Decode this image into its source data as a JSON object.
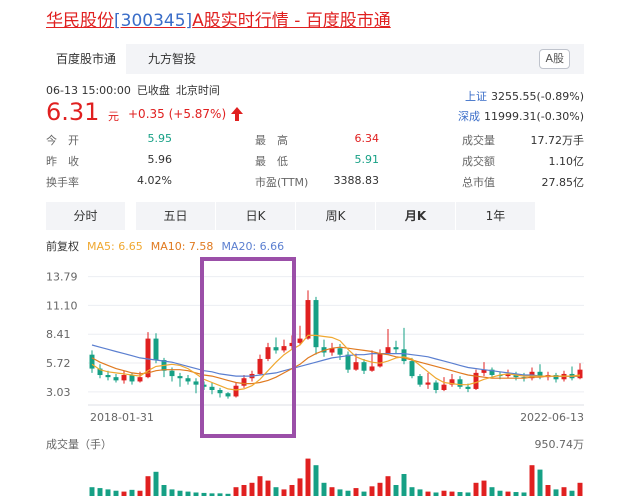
{
  "header": {
    "name": "华民股份",
    "code": "[300345]",
    "suffix": "A股实时行情 - 百度股市通"
  },
  "tabs": [
    {
      "label": "百度股市通",
      "active": true
    },
    {
      "label": "九方智投",
      "active": false
    }
  ],
  "market_badge": "A股",
  "status": {
    "datetime": "06-13 15:00:00",
    "state": "已收盘",
    "timezone": "北京时间"
  },
  "quote": {
    "price": "6.31",
    "unit": "元",
    "change": "+0.35 (+5.87%)"
  },
  "indices": [
    {
      "name": "上证",
      "value": "3255.55(-0.89%)"
    },
    {
      "name": "深成",
      "value": "11999.31(-0.30%)"
    }
  ],
  "stats": {
    "open": {
      "label": "今　开",
      "value": "5.95"
    },
    "prev": {
      "label": "昨　收",
      "value": "5.96"
    },
    "turnover": {
      "label": "换手率",
      "value": "4.02%"
    },
    "high": {
      "label": "最　高",
      "value": "6.34"
    },
    "low": {
      "label": "最　低",
      "value": "5.91"
    },
    "pe": {
      "label": "市盈(TTM)",
      "value": "3388.83"
    },
    "volume": {
      "label": "成交量",
      "value": "17.72万手"
    },
    "amount": {
      "label": "成交额",
      "value": "1.10亿"
    },
    "mktcap": {
      "label": "总市值",
      "value": "27.85亿"
    }
  },
  "periods": [
    {
      "label": "分时",
      "active": false
    },
    {
      "label": "五日",
      "active": false
    },
    {
      "label": "日K",
      "active": false
    },
    {
      "label": "周K",
      "active": false
    },
    {
      "label": "月K",
      "active": true
    },
    {
      "label": "1年",
      "active": false
    }
  ],
  "ma": {
    "label": "前复权",
    "ma5": "MA5: 6.65",
    "ma10": "MA10: 7.58",
    "ma20": "MA20: 6.66"
  },
  "colors": {
    "up": "#e02020",
    "down": "#16a085",
    "ma5": "#f0a830",
    "ma10": "#e07a20",
    "ma20": "#5b7fd0",
    "highlight": "#9b4fa8"
  },
  "volume_panel": {
    "title": "成交量（手）",
    "max_label": "950.74万"
  },
  "chart_data": {
    "type": "candlestick",
    "y_ticks": [
      "13.79",
      "11.10",
      "8.41",
      "5.72",
      "3.03"
    ],
    "ylim": [
      1.8,
      14.5
    ],
    "x_start": "2018-01-31",
    "x_end": "2022-06-13",
    "candles": [
      [
        6.5,
        5.2,
        6.9,
        4.8
      ],
      [
        5.2,
        4.6,
        5.6,
        4.3
      ],
      [
        4.6,
        4.4,
        5.0,
        4.1
      ],
      [
        4.4,
        4.1,
        4.7,
        3.9
      ],
      [
        4.1,
        4.6,
        5.0,
        3.8
      ],
      [
        4.6,
        4.0,
        4.8,
        3.7
      ],
      [
        4.0,
        4.4,
        4.9,
        3.9
      ],
      [
        4.4,
        8.0,
        8.6,
        4.3
      ],
      [
        8.0,
        6.0,
        8.5,
        5.7
      ],
      [
        6.0,
        5.0,
        6.2,
        4.4
      ],
      [
        5.0,
        4.5,
        5.3,
        4.0
      ],
      [
        4.5,
        4.3,
        4.8,
        3.5
      ],
      [
        4.3,
        4.0,
        4.6,
        3.7
      ],
      [
        4.0,
        3.7,
        4.3,
        2.9
      ],
      [
        3.7,
        3.5,
        4.0,
        3.2
      ],
      [
        3.5,
        3.2,
        3.9,
        2.8
      ],
      [
        3.2,
        2.9,
        3.4,
        2.5
      ],
      [
        2.9,
        2.6,
        3.0,
        2.4
      ],
      [
        2.6,
        3.6,
        3.9,
        2.5
      ],
      [
        3.6,
        4.3,
        4.6,
        3.4
      ],
      [
        4.3,
        4.7,
        5.0,
        4.0
      ],
      [
        4.7,
        6.1,
        6.5,
        4.6
      ],
      [
        6.1,
        7.2,
        7.6,
        5.9
      ],
      [
        7.2,
        6.9,
        8.1,
        6.6
      ],
      [
        6.9,
        7.3,
        7.9,
        6.7
      ],
      [
        7.3,
        7.6,
        8.3,
        7.0
      ],
      [
        7.6,
        8.0,
        9.2,
        7.4
      ],
      [
        8.0,
        11.6,
        12.5,
        7.9
      ],
      [
        11.6,
        7.2,
        11.9,
        6.5
      ],
      [
        7.2,
        6.7,
        7.9,
        6.3
      ],
      [
        6.7,
        7.1,
        7.6,
        6.4
      ],
      [
        7.1,
        6.5,
        7.5,
        6.0
      ],
      [
        6.5,
        5.1,
        6.8,
        4.8
      ],
      [
        5.1,
        5.8,
        6.6,
        5.0
      ],
      [
        5.8,
        5.0,
        6.1,
        4.7
      ],
      [
        5.0,
        5.4,
        6.9,
        4.9
      ],
      [
        5.4,
        6.6,
        7.0,
        5.3
      ],
      [
        6.6,
        7.2,
        8.9,
        6.5
      ],
      [
        7.2,
        7.0,
        7.8,
        6.6
      ],
      [
        7.0,
        5.9,
        9.0,
        5.6
      ],
      [
        5.9,
        4.5,
        6.2,
        4.3
      ],
      [
        4.5,
        3.7,
        4.7,
        3.5
      ],
      [
        3.7,
        3.9,
        4.8,
        3.3
      ],
      [
        3.9,
        3.2,
        4.1,
        2.9
      ],
      [
        3.2,
        3.7,
        4.4,
        3.1
      ],
      [
        3.7,
        4.2,
        4.7,
        3.5
      ],
      [
        4.2,
        3.5,
        4.5,
        3.3
      ],
      [
        3.5,
        3.3,
        3.8,
        3.0
      ],
      [
        3.3,
        4.8,
        5.1,
        3.2
      ],
      [
        4.8,
        5.1,
        5.8,
        4.5
      ],
      [
        5.1,
        4.6,
        5.3,
        4.3
      ],
      [
        4.6,
        4.5,
        4.9,
        4.2
      ],
      [
        4.5,
        4.7,
        5.1,
        4.3
      ],
      [
        4.7,
        4.4,
        4.9,
        4.1
      ],
      [
        4.4,
        4.3,
        4.8,
        4.0
      ],
      [
        4.3,
        4.9,
        5.3,
        4.1
      ],
      [
        4.9,
        4.4,
        5.6,
        4.2
      ],
      [
        4.4,
        4.6,
        4.9,
        4.1
      ],
      [
        4.6,
        4.2,
        4.8,
        3.9
      ],
      [
        4.2,
        4.7,
        5.0,
        4.0
      ],
      [
        4.7,
        4.3,
        5.4,
        4.1
      ],
      [
        4.3,
        5.1,
        5.7,
        4.2
      ]
    ],
    "ma5": [
      5.6,
      5.1,
      4.9,
      4.8,
      4.7,
      4.6,
      4.5,
      5.0,
      5.4,
      5.5,
      5.6,
      5.5,
      5.2,
      4.7,
      4.2,
      3.9,
      3.6,
      3.3,
      3.2,
      3.3,
      3.6,
      4.2,
      5.0,
      5.8,
      6.5,
      7.0,
      7.4,
      8.3,
      8.3,
      8.2,
      8.1,
      7.8,
      7.0,
      6.3,
      6.0,
      5.8,
      5.7,
      5.9,
      6.2,
      6.3,
      6.1,
      5.5,
      4.9,
      4.3,
      3.9,
      3.8,
      3.7,
      3.7,
      3.9,
      4.2,
      4.4,
      4.6,
      4.7,
      4.6,
      4.5,
      4.5,
      4.5,
      4.5,
      4.5,
      4.5,
      4.5,
      4.6
    ],
    "ma10": [
      6.2,
      5.8,
      5.5,
      5.2,
      5.0,
      4.8,
      4.7,
      4.8,
      5.0,
      5.1,
      5.1,
      5.1,
      5.0,
      4.8,
      4.6,
      4.5,
      4.3,
      4.1,
      3.9,
      3.8,
      3.8,
      3.9,
      4.1,
      4.4,
      4.8,
      5.2,
      5.6,
      6.2,
      6.6,
      6.9,
      7.1,
      7.2,
      7.1,
      7.0,
      6.9,
      6.8,
      6.6,
      6.5,
      6.3,
      6.2,
      6.0,
      5.8,
      5.6,
      5.4,
      5.2,
      5.0,
      4.8,
      4.6,
      4.5,
      4.4,
      4.3,
      4.3,
      4.3,
      4.3,
      4.3,
      4.4,
      4.4,
      4.5,
      4.5,
      4.5,
      4.5,
      4.5
    ],
    "ma20": [
      7.4,
      7.2,
      7.0,
      6.8,
      6.6,
      6.4,
      6.2,
      6.1,
      6.0,
      5.9,
      5.8,
      5.6,
      5.4,
      5.2,
      5.0,
      4.9,
      4.7,
      4.6,
      4.5,
      4.5,
      4.5,
      4.6,
      4.7,
      4.8,
      5.0,
      5.2,
      5.4,
      5.6,
      5.8,
      6.0,
      6.2,
      6.3,
      6.4,
      6.5,
      6.5,
      6.6,
      6.6,
      6.6,
      6.6,
      6.6,
      6.5,
      6.4,
      6.3,
      6.1,
      5.9,
      5.7,
      5.5,
      5.3,
      5.2,
      5.1,
      5.0,
      4.9,
      4.8,
      4.7,
      4.6,
      4.6,
      4.5,
      4.5,
      4.5,
      4.5,
      4.5,
      4.5
    ],
    "volume": [
      0.2,
      0.18,
      0.15,
      0.12,
      0.1,
      0.14,
      0.12,
      0.45,
      0.55,
      0.25,
      0.15,
      0.12,
      0.1,
      0.08,
      0.07,
      0.06,
      0.06,
      0.05,
      0.2,
      0.25,
      0.3,
      0.45,
      0.35,
      0.2,
      0.15,
      0.25,
      0.4,
      0.85,
      0.7,
      0.3,
      0.2,
      0.15,
      0.12,
      0.18,
      0.1,
      0.22,
      0.3,
      0.45,
      0.25,
      0.5,
      0.2,
      0.15,
      0.1,
      0.08,
      0.12,
      0.1,
      0.09,
      0.08,
      0.3,
      0.35,
      0.2,
      0.12,
      0.1,
      0.09,
      0.08,
      0.7,
      0.6,
      0.25,
      0.15,
      0.2,
      0.12,
      0.3
    ]
  }
}
